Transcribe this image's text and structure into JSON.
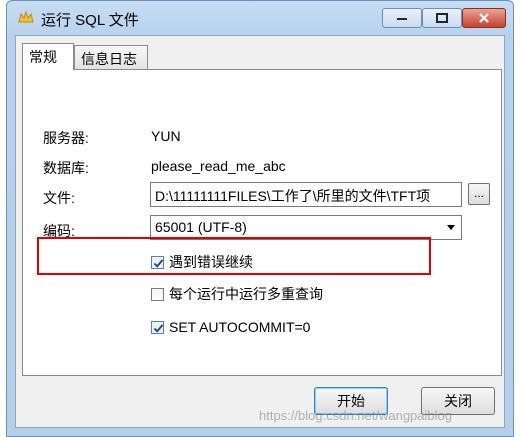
{
  "window": {
    "title": "运行 SQL 文件"
  },
  "tabs": [
    {
      "label": "常规",
      "active": true
    },
    {
      "label": "信息日志",
      "active": false
    }
  ],
  "form": {
    "server_label": "服务器:",
    "server_value": "YUN",
    "database_label": "数据库:",
    "database_value": "please_read_me_abc",
    "file_label": "文件:",
    "file_value": "D:\\11111111FILES\\工作了\\所里的文件\\TFT项",
    "browse_label": "...",
    "encoding_label": "编码:",
    "encoding_value": "65001 (UTF-8)"
  },
  "options": [
    {
      "label": "遇到错误继续",
      "checked": true
    },
    {
      "label": "每个运行中运行多重查询",
      "checked": false
    },
    {
      "label": "SET AUTOCOMMIT=0",
      "checked": true
    }
  ],
  "buttons": {
    "start": "开始",
    "close": "关闭"
  },
  "watermark": "https://blog.csdn.net/wangpaiblog"
}
